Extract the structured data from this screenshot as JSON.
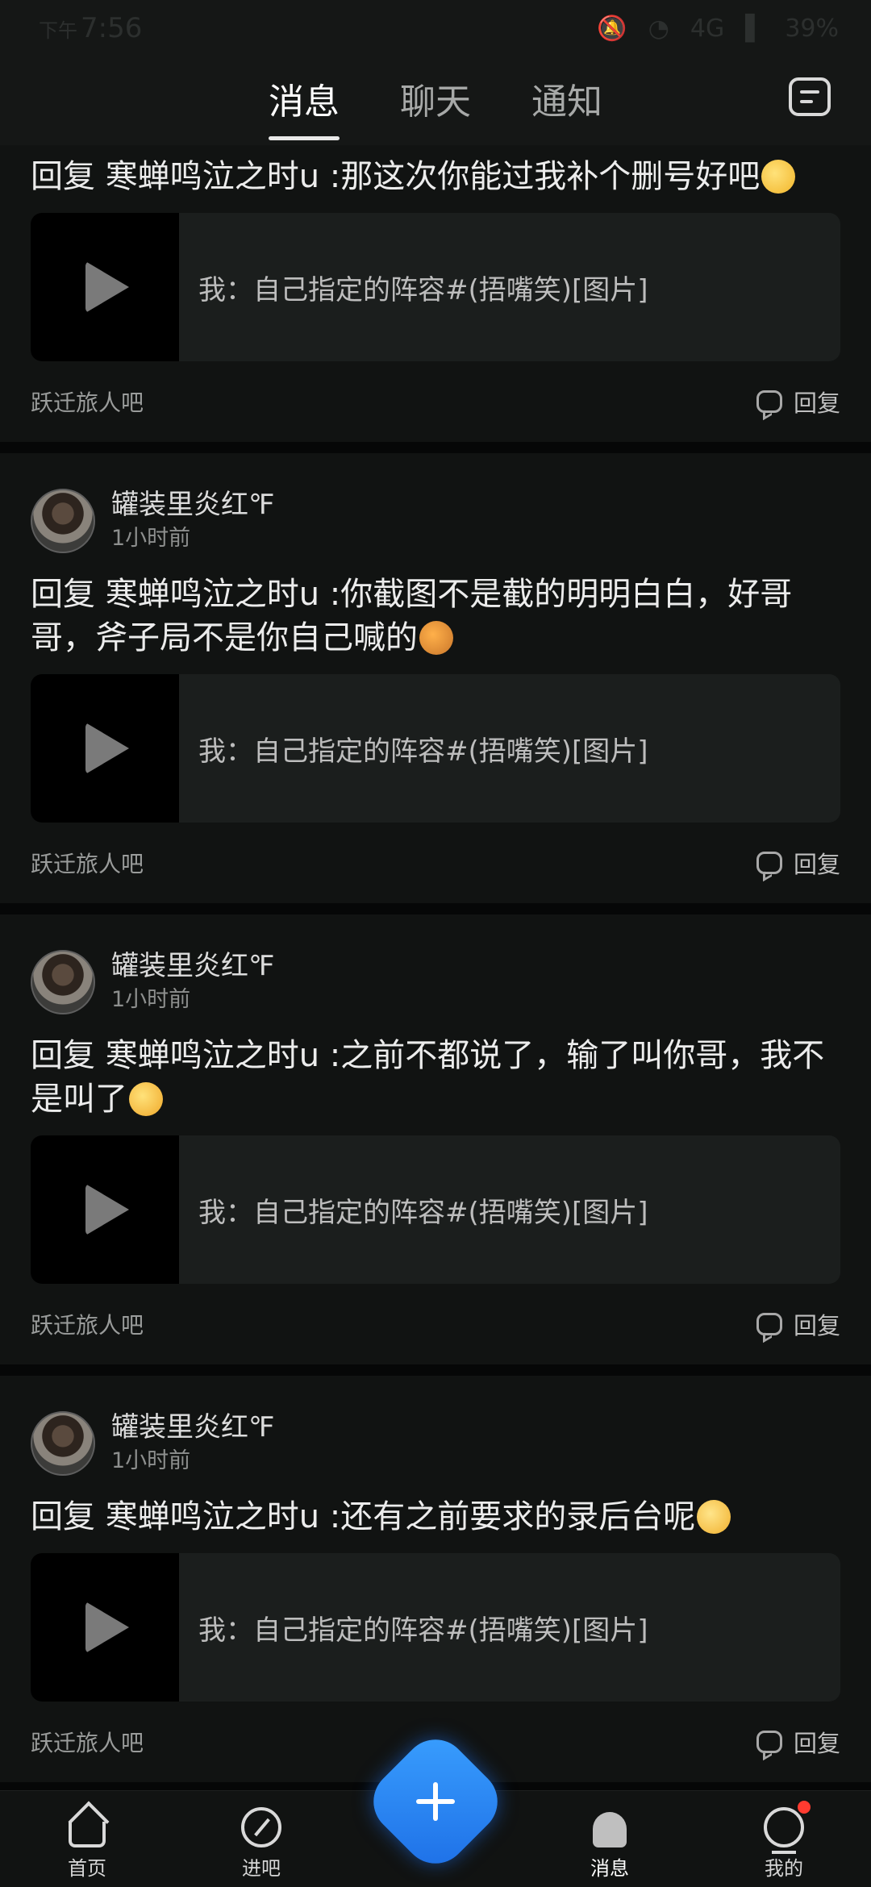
{
  "status_bar": {
    "ampm": "下午",
    "time": "7:56",
    "network": "4G",
    "battery": "39%"
  },
  "header": {
    "tabs": [
      {
        "label": "消息",
        "active": true
      },
      {
        "label": "聊天",
        "active": false
      },
      {
        "label": "通知",
        "active": false
      }
    ],
    "chat_list_icon": "chat-list-icon"
  },
  "messages": [
    {
      "username": "",
      "time": "",
      "reply_text": "回复 寒蝉鸣泣之时u :那这次你能过我补个删号好吧",
      "emoji": "sweat-emoji",
      "quote_text": "我：自己指定的阵容#(捂嘴笑)[图片]",
      "forum": "跃迁旅人吧",
      "reply_label": "回复"
    },
    {
      "username": "罐装里炎红℉",
      "time": "1小时前",
      "reply_text": "回复 寒蝉鸣泣之时u :你截图不是截的明明白白，好哥哥，斧子局不是你自己喊的",
      "emoji": "sad-emoji",
      "quote_text": "我：自己指定的阵容#(捂嘴笑)[图片]",
      "forum": "跃迁旅人吧",
      "reply_label": "回复"
    },
    {
      "username": "罐装里炎红℉",
      "time": "1小时前",
      "reply_text": "回复 寒蝉鸣泣之时u :之前不都说了，输了叫你哥，我不是叫了",
      "emoji": "kiss-emoji",
      "quote_text": "我：自己指定的阵容#(捂嘴笑)[图片]",
      "forum": "跃迁旅人吧",
      "reply_label": "回复"
    },
    {
      "username": "罐装里炎红℉",
      "time": "1小时前",
      "reply_text": "回复 寒蝉鸣泣之时u :还有之前要求的录后台呢",
      "emoji": "hug-emoji",
      "quote_text": "我：自己指定的阵容#(捂嘴笑)[图片]",
      "forum": "跃迁旅人吧",
      "reply_label": "回复"
    }
  ],
  "bottom_nav": [
    {
      "label": "首页",
      "icon": "home-icon"
    },
    {
      "label": "进吧",
      "icon": "compass-icon"
    },
    {
      "label": "",
      "icon": "plus-icon"
    },
    {
      "label": "消息",
      "icon": "message-icon"
    },
    {
      "label": "我的",
      "icon": "profile-icon"
    }
  ]
}
